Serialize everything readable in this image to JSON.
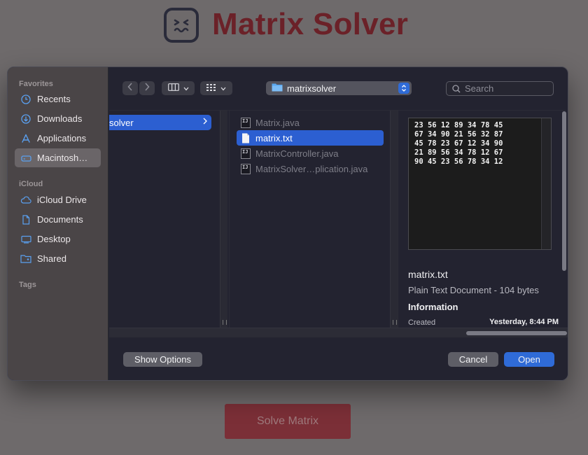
{
  "app": {
    "title": "Matrix Solver",
    "solve_button": "Solve Matrix",
    "brand_color": "#6b2128"
  },
  "dialog": {
    "sidebar": {
      "favorites_label": "Favorites",
      "favorites": [
        {
          "label": "Recents",
          "icon": "clock-icon"
        },
        {
          "label": "Downloads",
          "icon": "download-icon"
        },
        {
          "label": "Applications",
          "icon": "applications-icon"
        },
        {
          "label": "Macintosh…",
          "icon": "drive-icon",
          "selected": true
        }
      ],
      "icloud_label": "iCloud",
      "icloud": [
        {
          "label": "iCloud Drive",
          "icon": "cloud-icon"
        },
        {
          "label": "Documents",
          "icon": "document-icon"
        },
        {
          "label": "Desktop",
          "icon": "desktop-icon"
        },
        {
          "label": "Shared",
          "icon": "shared-folder-icon"
        }
      ],
      "tags_label": "Tags"
    },
    "toolbar": {
      "current_folder": "matrixsolver",
      "search_placeholder": "Search"
    },
    "columns": {
      "folder_item": "solver",
      "files": [
        {
          "name": "Matrix.java",
          "type": "java"
        },
        {
          "name": "matrix.txt",
          "type": "text",
          "selected": true
        },
        {
          "name": "MatrixController.java",
          "type": "java"
        },
        {
          "name": "MatrixSolver…plication.java",
          "type": "java"
        }
      ]
    },
    "preview": {
      "content": "23 56 12 89 34 78 45\n67 34 90 21 56 32 87\n45 78 23 67 12 34 90\n21 89 56 34 78 12 67\n90 45 23 56 78 34 12",
      "file_name": "matrix.txt",
      "file_type": "Plain Text Document - 104 bytes",
      "info_heading": "Information",
      "created_label": "Created",
      "created_value": "Yesterday, 8:44 PM"
    },
    "buttons": {
      "show_options": "Show Options",
      "cancel": "Cancel",
      "open": "Open"
    },
    "accent_color": "#2f6bd7"
  }
}
